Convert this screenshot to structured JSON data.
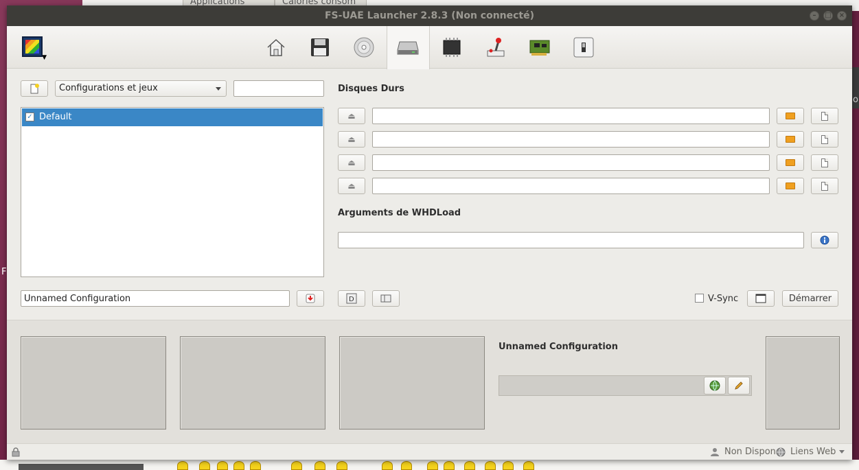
{
  "window": {
    "title": "FS-UAE Launcher 2.8.3 (Non connecté)"
  },
  "background": {
    "tabs": [
      "Applications",
      "Calories consom"
    ]
  },
  "toolbar": {
    "icons": [
      "home-icon",
      "floppy-icon",
      "cdrom-icon",
      "harddrive-icon",
      "chip-icon",
      "joystick-icon",
      "expansion-card-icon",
      "switch-icon"
    ],
    "selected": "harddrive-icon"
  },
  "left": {
    "filter": {
      "value": "Configurations et jeux"
    },
    "search": {
      "value": ""
    },
    "list": [
      {
        "label": "Default",
        "checked": true
      }
    ],
    "config_name": {
      "value": "Unnamed Configuration"
    }
  },
  "right": {
    "hard_drives_heading": "Disques Durs",
    "drives": [
      "",
      "",
      "",
      ""
    ],
    "whdload_heading": "Arguments de WHDLoad",
    "whdload_args": "",
    "vsync_label": "V-Sync",
    "vsync_checked": false,
    "start_label": "Démarrer"
  },
  "info": {
    "config_title": "Unnamed Configuration"
  },
  "status": {
    "net_label": "Non Dispon",
    "web_label": "Liens Web"
  }
}
